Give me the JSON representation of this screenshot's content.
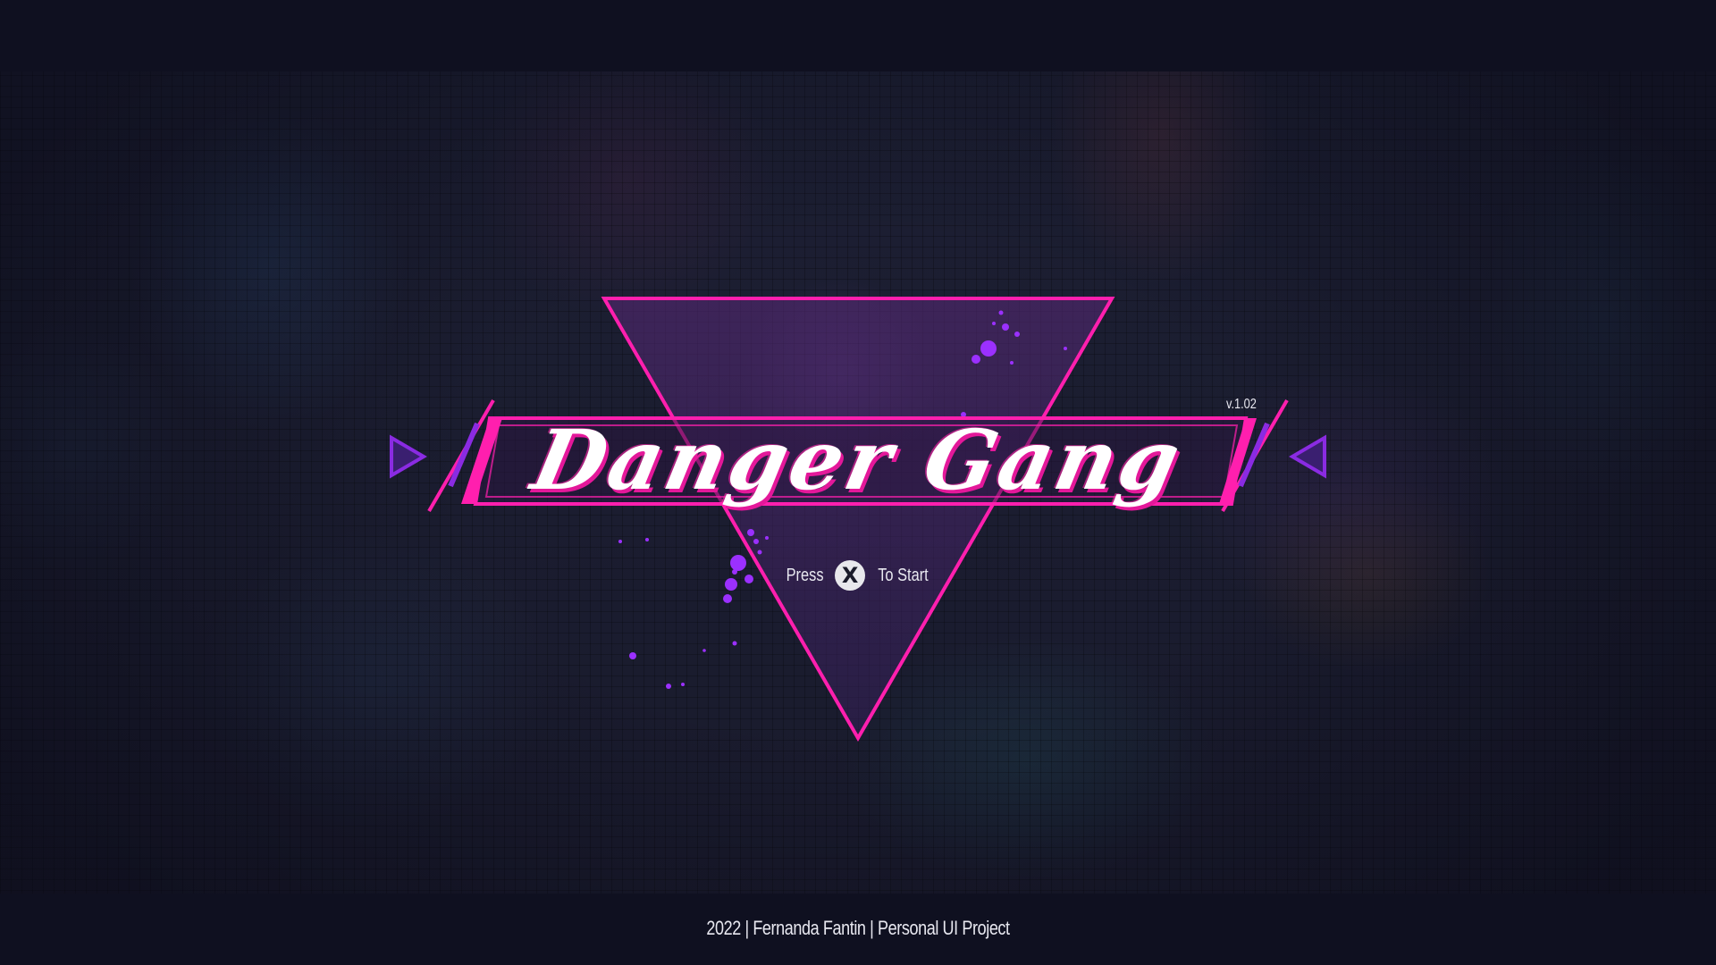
{
  "title_screen": {
    "game_title": "Danger Gang",
    "version": "v.1.02",
    "start_prompt": {
      "press_label": "Press",
      "button_glyph": "X",
      "start_label": "To Start"
    },
    "footer": "2022 | Fernanda Fantin | Personal UI Project"
  },
  "icons": {
    "left_arrow": "triangle-right-icon",
    "right_arrow": "triangle-left-icon",
    "x_button": "x-button-icon"
  },
  "colors": {
    "neon_pink": "#ff1fae",
    "neon_purple": "#8a2be2",
    "background": "#1b1d30",
    "bar": "#0f1020",
    "text": "#e8e8f0"
  }
}
